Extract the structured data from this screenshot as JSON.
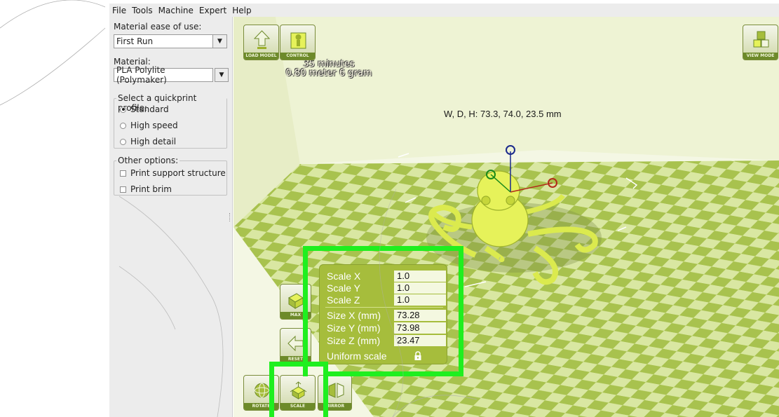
{
  "menu": {
    "items": [
      "File",
      "Tools",
      "Machine",
      "Expert",
      "Help"
    ]
  },
  "settings": {
    "ease_label": "Material ease of use:",
    "ease_value": "First Run",
    "material_label": "Material:",
    "material_value": "PLA Polylite (Polymaker)",
    "quickprint_label": "Select a quickprint profile:",
    "profiles": [
      "Standard",
      "High speed",
      "High detail"
    ],
    "selected_profile": "Standard",
    "other_label": "Other options:",
    "options": [
      "Print support structure",
      "Print brim"
    ],
    "dropdown_arrow": "▼"
  },
  "toolbar": {
    "load_label": "LOAD MODEL",
    "control_label": "CONTROL",
    "view_label": "VIEW MODE",
    "max_label": "MAX",
    "reset_label": "RESET",
    "rotate_label": "ROTATE",
    "scale_label": "SCALE",
    "mirror_label": "MIRROR"
  },
  "stats": {
    "time": "35 minutes",
    "material": "0.80 meter 6 gram"
  },
  "dimensions": "W, D, H: 73.3, 74.0, 23.5 mm",
  "scale_panel": {
    "scale_x_label": "Scale X",
    "scale_x": "1.0",
    "scale_y_label": "Scale Y",
    "scale_y": "1.0",
    "scale_z_label": "Scale Z",
    "scale_z": "1.0",
    "size_x_label": "Size X (mm)",
    "size_x": "73.28",
    "size_y_label": "Size Y (mm)",
    "size_y": "73.98",
    "size_z_label": "Size Z (mm)",
    "size_z": "23.47",
    "uniform_label": "Uniform scale"
  },
  "colors": {
    "bed_light": "#d9e7a2",
    "bed_dark": "#a8c24e",
    "wall": "#eef3d4",
    "model": "#e6f25a",
    "highlight": "#1fef1f"
  }
}
